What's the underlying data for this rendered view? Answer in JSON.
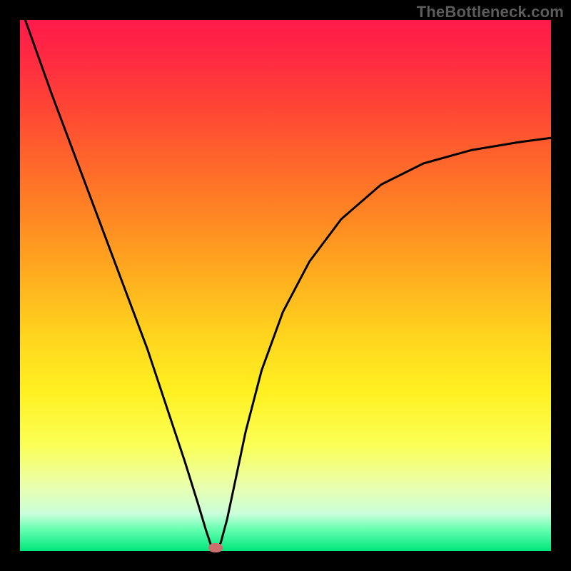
{
  "watermark": "TheBottleneck.com",
  "chart_data": {
    "type": "line",
    "title": "",
    "xlabel": "",
    "ylabel": "",
    "xlim": [
      0,
      1
    ],
    "ylim": [
      0,
      1
    ],
    "series": [
      {
        "name": "curve",
        "x": [
          0.01,
          0.06,
          0.12,
          0.18,
          0.24,
          0.28,
          0.31,
          0.335,
          0.35,
          0.36,
          0.368,
          0.378,
          0.39,
          0.405,
          0.425,
          0.455,
          0.495,
          0.545,
          0.605,
          0.68,
          0.76,
          0.85,
          0.94,
          1.0
        ],
        "y": [
          1.0,
          0.86,
          0.7,
          0.54,
          0.38,
          0.26,
          0.17,
          0.09,
          0.04,
          0.01,
          0.0,
          0.015,
          0.06,
          0.13,
          0.225,
          0.34,
          0.45,
          0.545,
          0.625,
          0.69,
          0.73,
          0.755,
          0.77,
          0.778
        ]
      }
    ],
    "marker": {
      "x": 0.368,
      "y": 0.005
    },
    "gradient_stops": [
      {
        "pos": 0.0,
        "color": "#ff1a4b"
      },
      {
        "pos": 0.5,
        "color": "#ffd61e"
      },
      {
        "pos": 0.8,
        "color": "#fbff55"
      },
      {
        "pos": 1.0,
        "color": "#00e67a"
      }
    ]
  }
}
